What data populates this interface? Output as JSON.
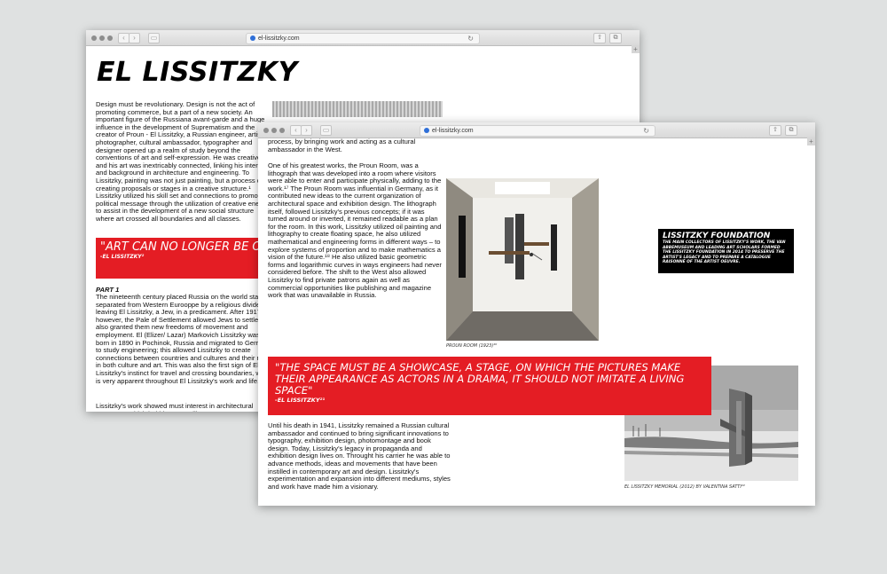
{
  "browser": {
    "url": "el-lissitzky.com"
  },
  "back_page": {
    "title": "EL LISSITZKY",
    "intro": "Design must be revolutionary. Design is not the act of promoting commerce, but a part of a new society. An important figure of the Russiana avant-garde and a huge influence in the development of Suprematism and the creator of Proun - El Lissitzky, a Russian engineer, artist, photographer, cultural ambassador, typographer and designer opened up a realm of study beyond the conventions of art and self-expression. He was creative and his art was inextricably connected, linking his interests and background in architecture and engineering. To Lissitzky, painting was not just painting, but a process of creating proposals or stages in a creative structure.¹ Lissitzky utilized his skill set and connections to promote a political message through the utilization of creative energy to assist in the development of a new social structure where art crossed all boundaries and all classes.",
    "quote_text": "\"ART CAN NO LONGER BE ORGANIZER OF THE PEOP",
    "quote_attr": "-EL LISSITZKY²",
    "part_heading": "PART 1",
    "part1": "The nineteenth century placed Russia on the world stage, separated from Western Eurooppe by a religious divide, leaving El Lissitzky, a Jew, in a predicament. After 1917, however, the Pale of Settlement allowed Jews to settle and also granted them new freedoms of movement and employment. El (Elizer/ Lazar) Markovich Lissitzky was born in 1890 in Pochinok, Russia and migrated to Germany to study engineering; this allowed Lissitzky to create connections between countries and cultures and their role in both culture and art. This was also the first sign of El Lissitzky's instinct for travel and crossing boundaries, which is very apparent throughout El Lissitzky's work and life.",
    "part1_end": "Lissitzky's work showed must interest in architectural structures, which led him to enrolling"
  },
  "front_page": {
    "top_text": "process, by bringing work and acting as a cultural ambassador in the West.",
    "proun_text": "One of his greatest works, the Proun Room, was a lithograph that was developed into a room where visitors were able to enter and participate physically, adding to the work.¹⁷ The Proun Room was influential in Germany, as it contributed new ideas to the current organization of architectural space and exhibition design. The lithograph itself, followed Lissitzky's previous concepts; if it was turned around or inverted, it remained readable as a plan for the room. In this work, Lissitzky utilized oil painting and lithography to create floating space, he also utilized mathematical and engineering forms in different ways – to explore systems of proportion and to make mathematics a vision of the future.¹⁸ He also utilized basic geometric forms and logarithmic curves in ways engineers had never considered before. The shift to the West also allowed Lissitzky to find private patrons again as well as commercial opportunities like publishing and magazine work that was unavailable in Russia.",
    "proun_caption": "PROUN ROOM (1923)²⁰",
    "foundation_heading": "LISSITZKY FOUNDATION",
    "foundation_text": "THE MAIN COLLECTORS OF LISSITZKY'S WORK, THE VAN ABBEMUSEUM AND LEADING ART SCHOLARS FORMED THE LISSITZKY FOUNDATION IN 2014 TO PRESERVE THE ARTIST'S LEGACY AND TO PREPARE A CATALOGUE RAISONNÉ OF THE ARTIST OEUVRE.",
    "quote_text": "\"THE SPACE MUST BE A SHOWCASE, A STAGE, ON WHICH THE PICTURES MAKE THEIR APPEARANCE AS ACTORS IN A DRAMA, IT SHOULD NOT IMITATE A LIVING SPACE\"",
    "quote_attr": "-EL LISSITZKY²¹",
    "bottom_text": "Until his death in 1941, Lissitzky remained a Russian cultural ambassador and continued to bring significant innovations to typography, exhibition design, photomontage and book design. Today, Lissitzky's legacy in propaganda and exhibition design lives on. Throught his carrier he was able to advance methods, ideas and movements that have been instilled in contemporary art and design. Lissitzky's experimentation and expansion into different mediums, styles and work have made him a visionary.",
    "memorial_caption": "EL LISSITZKY MEMORIAL (2012) BY VALENTINA SATTI²²"
  },
  "colors": {
    "accent_red": "#e41d24",
    "background": "#dfe1e1"
  }
}
